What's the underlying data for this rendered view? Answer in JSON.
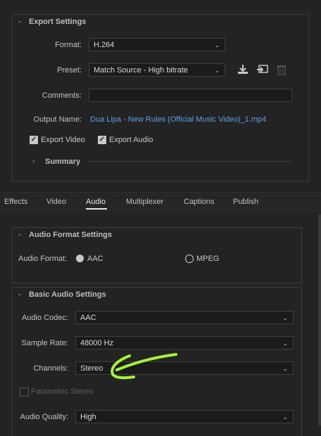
{
  "export_settings": {
    "title": "Export Settings",
    "format_label": "Format:",
    "format_value": "H.264",
    "preset_label": "Preset:",
    "preset_value": "Match Source - High bitrate",
    "comments_label": "Comments:",
    "comments_value": "",
    "output_label": "Output Name:",
    "output_value": "Dua Lipa - New Rules (Official Music Video)_1.mp4",
    "export_video_label": "Export Video",
    "export_video_checked": true,
    "export_audio_label": "Export Audio",
    "export_audio_checked": true,
    "summary_label": "Summary"
  },
  "tabs": [
    {
      "label": "Effects"
    },
    {
      "label": "Video"
    },
    {
      "label": "Audio"
    },
    {
      "label": "Multiplexer"
    },
    {
      "label": "Captions"
    },
    {
      "label": "Publish"
    }
  ],
  "active_tab": "Audio",
  "audio_format": {
    "title": "Audio Format Settings",
    "label": "Audio Format:",
    "options": [
      "AAC",
      "MPEG"
    ],
    "selected": "AAC"
  },
  "basic_audio": {
    "title": "Basic Audio Settings",
    "codec_label": "Audio Codec:",
    "codec_value": "AAC",
    "sample_rate_label": "Sample Rate:",
    "sample_rate_value": "48000 Hz",
    "channels_label": "Channels:",
    "channels_value": "Stereo",
    "parametric_label": "Parametric Stereo",
    "parametric_checked": false,
    "quality_label": "Audio Quality:",
    "quality_value": "High"
  },
  "colors": {
    "background": "#232323",
    "link": "#5aa0e6",
    "annotation": "#a6f23a"
  }
}
